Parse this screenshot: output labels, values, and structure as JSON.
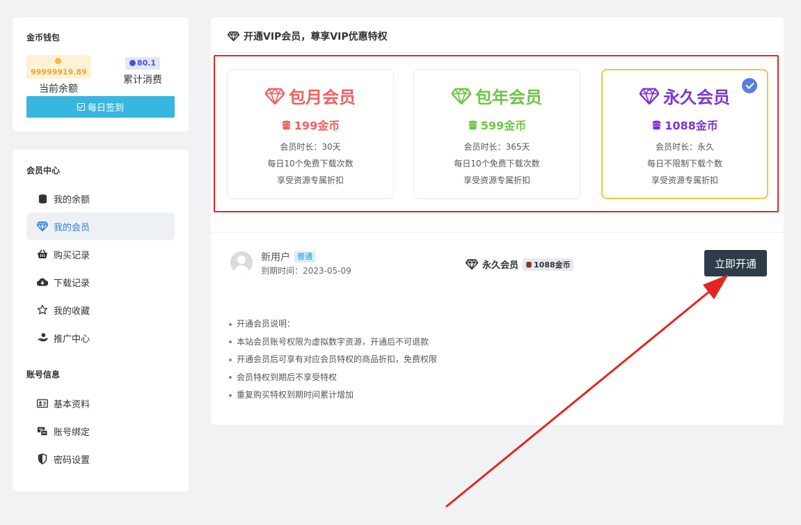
{
  "colors": {
    "monthly": "#f0615f",
    "yearly": "#6cc644",
    "forever": "#7b35d6",
    "accent_button": "#37b6df",
    "dark_button": "#2e3b48",
    "annotation": "#e4261f"
  },
  "wallet": {
    "title": "金币钱包",
    "balance_value": "99999919.89",
    "balance_label": "当前余额",
    "spent_value": "80.1",
    "spent_label": "累计消费",
    "checkin_label": "每日签到"
  },
  "menu": {
    "member_section": "会员中心",
    "member_items": [
      {
        "label": "我的余额",
        "icon": "coins-icon"
      },
      {
        "label": "我的会员",
        "icon": "diamond-icon"
      },
      {
        "label": "购买记录",
        "icon": "basket-icon"
      },
      {
        "label": "下载记录",
        "icon": "cloud-download-icon"
      },
      {
        "label": "我的收藏",
        "icon": "star-icon"
      },
      {
        "label": "推广中心",
        "icon": "hand-coin-icon"
      }
    ],
    "account_section": "账号信息",
    "account_items": [
      {
        "label": "基本资料",
        "icon": "id-card-icon"
      },
      {
        "label": "账号绑定",
        "icon": "link-icon"
      },
      {
        "label": "密码设置",
        "icon": "shield-icon"
      }
    ]
  },
  "main": {
    "header": "开通VIP会员，尊享VIP优惠特权",
    "plans": [
      {
        "name": "包月会员",
        "price": "199金币",
        "lines": [
          "会员时长：30天",
          "每日10个免费下载次数",
          "享受资源专属折扣"
        ]
      },
      {
        "name": "包年会员",
        "price": "599金币",
        "lines": [
          "会员时长：365天",
          "每日10个免费下载次数",
          "享受资源专属折扣"
        ]
      },
      {
        "name": "永久会员",
        "price": "1088金币",
        "lines": [
          "会员时长：永久",
          "每日不限制下载个数",
          "享受资源专属折扣"
        ]
      }
    ],
    "user": {
      "name": "新用户",
      "level": "普通",
      "expiry": "到期时间：2023-05-09"
    },
    "selected_plan": {
      "name": "永久会员",
      "price": "1088金币"
    },
    "open_button": "立即开通",
    "notes": [
      "开通会员说明：",
      "本站会员账号权限为虚拟数字资源，开通后不可退款",
      "开通会员后可享有对应会员特权的商品折扣，免费权限",
      "会员特权到期后不享受特权",
      "重复购买特权到期时间累计增加"
    ]
  }
}
